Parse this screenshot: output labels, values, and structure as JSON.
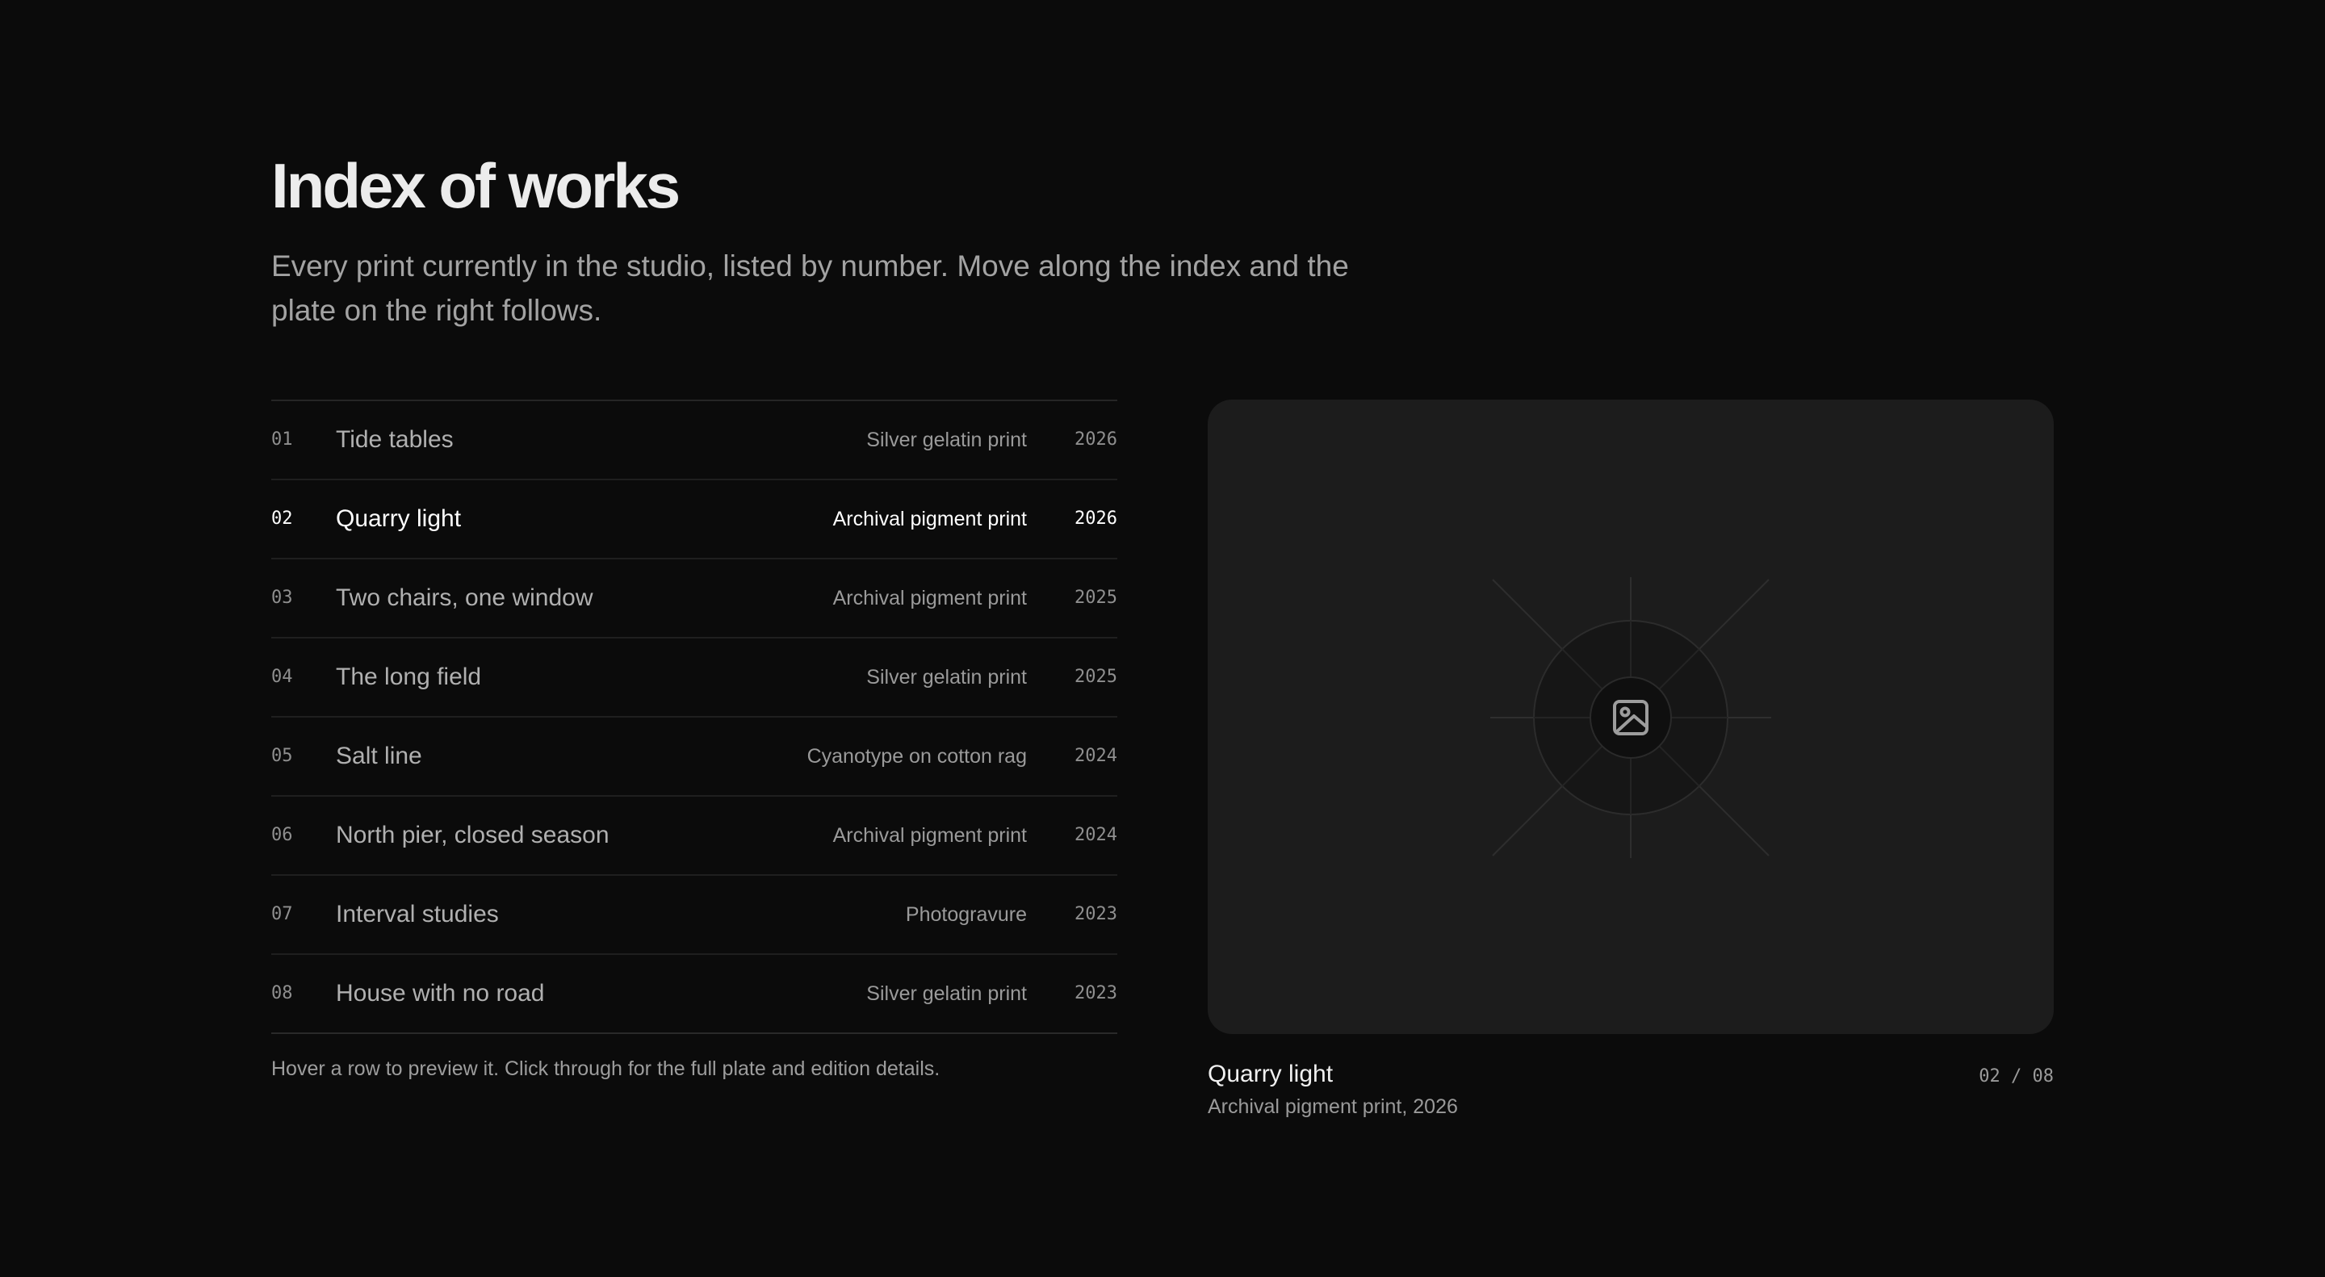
{
  "header": {
    "title": "Index of works",
    "intro": "Every print currently in the studio, listed by number. Move along the index and the plate on the right follows."
  },
  "works": [
    {
      "num": "01",
      "name": "Tide tables",
      "medium": "Silver gelatin print",
      "year": "2026"
    },
    {
      "num": "02",
      "name": "Quarry light",
      "medium": "Archival pigment print",
      "year": "2026"
    },
    {
      "num": "03",
      "name": "Two chairs, one window",
      "medium": "Archival pigment print",
      "year": "2025"
    },
    {
      "num": "04",
      "name": "The long field",
      "medium": "Silver gelatin print",
      "year": "2025"
    },
    {
      "num": "05",
      "name": "Salt line",
      "medium": "Cyanotype on cotton rag",
      "year": "2024"
    },
    {
      "num": "06",
      "name": "North pier, closed season",
      "medium": "Archival pigment print",
      "year": "2024"
    },
    {
      "num": "07",
      "name": "Interval studies",
      "medium": "Photogravure",
      "year": "2023"
    },
    {
      "num": "08",
      "name": "House with no road",
      "medium": "Silver gelatin print",
      "year": "2023"
    }
  ],
  "active_index": 1,
  "hint": "Hover a row to preview it. Click through for the full plate and edition details.",
  "preview": {
    "icon": "image-icon",
    "title": "Quarry light",
    "subtitle": "Archival pigment print, 2026",
    "counter": "02 / 08"
  },
  "colors": {
    "background": "#0b0b0b",
    "plate": "#1c1c1c",
    "active_text": "#ffffff",
    "muted_text": "#9a9a9a"
  }
}
